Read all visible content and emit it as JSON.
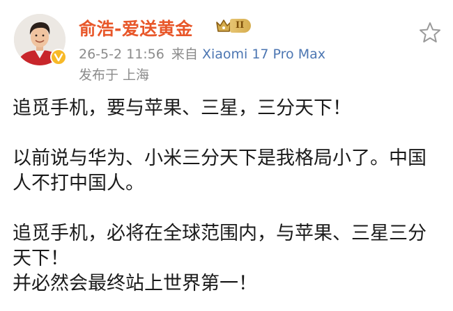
{
  "post": {
    "author": {
      "name": "俞浩-爱送黄金",
      "level_badge": "II",
      "avatar_icon": "avatar-portrait",
      "verified_icon": "verified-v-icon"
    },
    "meta": {
      "timestamp": "26-5-2 11:56",
      "source_prefix": "来自",
      "source_device": "Xiaomi 17 Pro Max",
      "location": "发布于 上海"
    },
    "paragraphs": [
      [
        "追觅手机，要与苹果、三星，三分天下！"
      ],
      [
        "以前说与华为、小米三分天下是我格局小了。中国",
        "人不打中国人。"
      ],
      [
        "追觅手机，必将在全球范围内，与苹果、三星三分",
        "天下！",
        "并必然会最终站上世界第一！"
      ]
    ]
  },
  "colors": {
    "username": "#e8572a",
    "source_link": "#4c76b2",
    "meta_gray": "#8b8b8b",
    "badge_gold": "#d6ad4e",
    "verified_gold": "#f7b928"
  },
  "icons": {
    "favorite": "star-outline-icon",
    "crown": "crown-icon"
  }
}
